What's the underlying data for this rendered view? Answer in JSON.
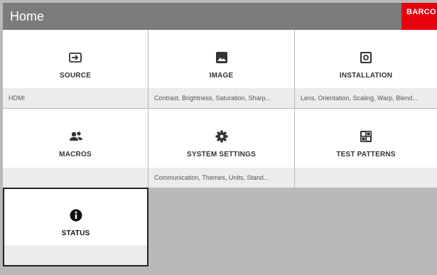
{
  "header": {
    "title": "Home",
    "logo_text": "BARCO",
    "logo_color": "#e8000f"
  },
  "tiles": [
    {
      "label": "SOURCE",
      "subtitle": "HDMI",
      "icon": "input-icon"
    },
    {
      "label": "IMAGE",
      "subtitle": "Contrast, Brightness, Saturation, Sharp...",
      "icon": "image-icon"
    },
    {
      "label": "INSTALLATION",
      "subtitle": "Lens, Orientation, Scaling, Warp, Blend...",
      "icon": "projector-icon"
    },
    {
      "label": "MACROS",
      "subtitle": "",
      "icon": "people-icon"
    },
    {
      "label": "SYSTEM SETTINGS",
      "subtitle": "Communication, Themes, Units, Stand...",
      "icon": "gear-icon"
    },
    {
      "label": "TEST PATTERNS",
      "subtitle": "",
      "icon": "grid-pattern-icon"
    },
    {
      "label": "STATUS",
      "subtitle": "",
      "icon": "info-icon"
    }
  ]
}
